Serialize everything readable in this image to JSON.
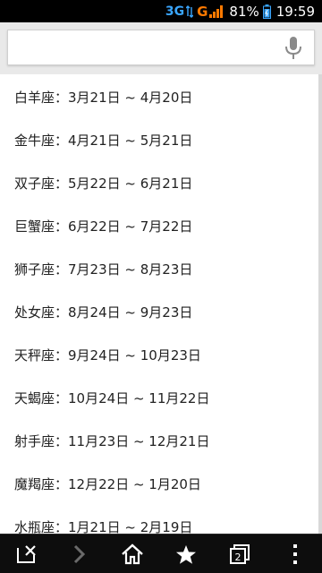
{
  "status_bar": {
    "network": "3G",
    "carrier": "G",
    "battery": "81%",
    "time": "19:59",
    "colors": {
      "network": "#3aa6ff",
      "carrier": "#ff7a00"
    }
  },
  "search": {
    "value": "",
    "placeholder": ""
  },
  "zodiac": [
    {
      "name": "白羊座",
      "range": "：3月21日 ~ 4月20日"
    },
    {
      "name": "金牛座",
      "range": "：4月21日 ~ 5月21日"
    },
    {
      "name": "双子座",
      "range": "：5月22日 ~ 6月21日"
    },
    {
      "name": "巨蟹座",
      "range": "：6月22日 ~ 7月22日"
    },
    {
      "name": "狮子座",
      "range": "：7月23日 ~ 8月23日"
    },
    {
      "name": "处女座",
      "range": "：8月24日 ~ 9月23日"
    },
    {
      "name": "天秤座",
      "range": "：9月24日 ~ 10月23日"
    },
    {
      "name": "天蝎座",
      "range": "：10月24日 ~ 11月22日"
    },
    {
      "name": "射手座",
      "range": "：11月23日 ~ 12月21日"
    },
    {
      "name": "魔羯座",
      "range": "：12月22日 ~ 1月20日"
    },
    {
      "name": "水瓶座",
      "range": "：1月21日 ~ 2月19日"
    }
  ],
  "toolbar": {
    "tabs_count": "2",
    "icons": [
      "close-tab-icon",
      "forward-icon",
      "home-icon",
      "bookmark-star-icon",
      "tabs-icon",
      "overflow-menu-icon"
    ]
  }
}
